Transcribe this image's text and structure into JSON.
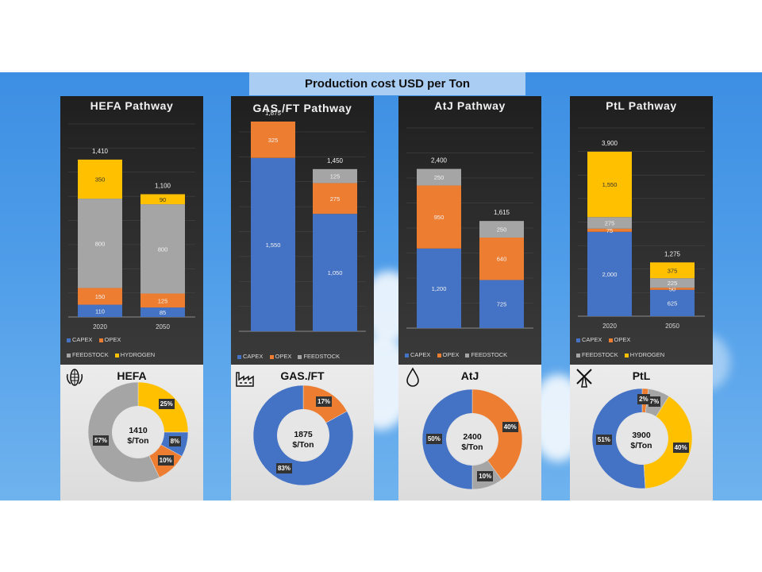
{
  "page_title": "Production cost USD per Ton",
  "colors": {
    "capex": "#4472c4",
    "opex": "#ed7d31",
    "feedstock": "#a5a5a5",
    "hydrogen": "#ffc000"
  },
  "legend_labels": {
    "capex": "CAPEX",
    "opex": "OPEX",
    "feedstock": "FEEDSTOCK",
    "hydrogen": "HYDROGEN"
  },
  "chart_data": [
    {
      "type": "bar",
      "title": "HEFA Pathway",
      "categories": [
        "2020",
        "2050"
      ],
      "series": [
        {
          "name": "CAPEX",
          "values": [
            110,
            85
          ]
        },
        {
          "name": "OPEX",
          "values": [
            150,
            125
          ]
        },
        {
          "name": "FEEDSTOCK",
          "values": [
            800,
            800
          ]
        },
        {
          "name": "HYDROGEN",
          "values": [
            350,
            90
          ]
        }
      ],
      "totals": [
        "1,410",
        "1,100"
      ],
      "donut": {
        "name": "HEFA",
        "center_value": "1410",
        "center_unit": "$/Ton",
        "slices": [
          {
            "series": "HYDROGEN",
            "pct": 25
          },
          {
            "series": "CAPEX",
            "pct": 8
          },
          {
            "series": "OPEX",
            "pct": 10
          },
          {
            "series": "FEEDSTOCK",
            "pct": 57
          }
        ]
      }
    },
    {
      "type": "bar",
      "title": "GAS./FT Pathway",
      "categories": [
        "2020",
        "2050"
      ],
      "series": [
        {
          "name": "CAPEX",
          "values": [
            1550,
            1050
          ]
        },
        {
          "name": "OPEX",
          "values": [
            325,
            275
          ]
        },
        {
          "name": "FEEDSTOCK",
          "values": [
            0,
            125
          ]
        }
      ],
      "totals": [
        "1,875",
        "1,450"
      ],
      "donut": {
        "name": "GAS./FT",
        "center_value": "1875",
        "center_unit": "$/Ton",
        "slices": [
          {
            "series": "OPEX",
            "pct": 17
          },
          {
            "series": "CAPEX",
            "pct": 83
          }
        ]
      }
    },
    {
      "type": "bar",
      "title": "AtJ Pathway",
      "categories": [
        "2020",
        "2050"
      ],
      "series": [
        {
          "name": "CAPEX",
          "values": [
            1200,
            725
          ]
        },
        {
          "name": "OPEX",
          "values": [
            950,
            640
          ]
        },
        {
          "name": "FEEDSTOCK",
          "values": [
            250,
            250
          ]
        }
      ],
      "totals": [
        "2,400",
        "1,615"
      ],
      "donut": {
        "name": "AtJ",
        "center_value": "2400",
        "center_unit": "$/Ton",
        "slices": [
          {
            "series": "OPEX",
            "pct": 40
          },
          {
            "series": "FEEDSTOCK",
            "pct": 10
          },
          {
            "series": "CAPEX",
            "pct": 50
          }
        ]
      }
    },
    {
      "type": "bar",
      "title": "PtL Pathway",
      "categories": [
        "2020",
        "2050"
      ],
      "series": [
        {
          "name": "CAPEX",
          "values": [
            2000,
            625
          ]
        },
        {
          "name": "OPEX",
          "values": [
            75,
            50
          ]
        },
        {
          "name": "FEEDSTOCK",
          "values": [
            275,
            225
          ]
        },
        {
          "name": "HYDROGEN",
          "values": [
            1550,
            375
          ]
        }
      ],
      "totals": [
        "3,900",
        "1,275"
      ],
      "donut": {
        "name": "PtL",
        "center_value": "3900",
        "center_unit": "$/Ton",
        "slices": [
          {
            "series": "OPEX",
            "pct": 2
          },
          {
            "series": "FEEDSTOCK",
            "pct": 7
          },
          {
            "series": "HYDROGEN",
            "pct": 40
          },
          {
            "series": "CAPEX",
            "pct": 51
          }
        ]
      }
    }
  ]
}
